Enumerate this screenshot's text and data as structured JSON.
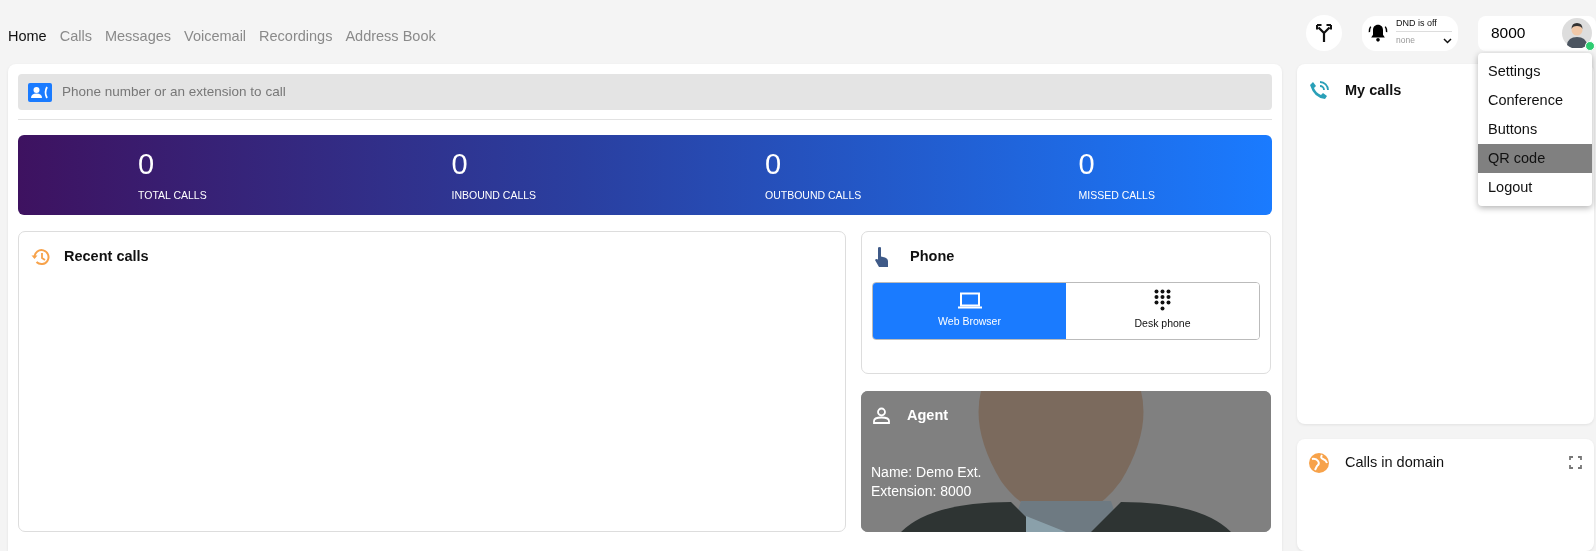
{
  "nav": {
    "tabs": [
      {
        "label": "Home",
        "selected": true
      },
      {
        "label": "Calls",
        "selected": false
      },
      {
        "label": "Messages",
        "selected": false
      },
      {
        "label": "Voicemail",
        "selected": false
      },
      {
        "label": "Recordings",
        "selected": false
      },
      {
        "label": "Address Book",
        "selected": false
      }
    ]
  },
  "header": {
    "dnd": {
      "status": "DND is off",
      "value": "none"
    },
    "user": {
      "extension": "8000",
      "online": true
    },
    "menu": [
      {
        "label": "Settings",
        "selected": false
      },
      {
        "label": "Conference",
        "selected": false
      },
      {
        "label": "Buttons",
        "selected": false
      },
      {
        "label": "QR code",
        "selected": true
      },
      {
        "label": "Logout",
        "selected": false
      }
    ]
  },
  "dialer": {
    "placeholder": "Phone number or an extension to call"
  },
  "stats": [
    {
      "value": "0",
      "label": "TOTAL CALLS"
    },
    {
      "value": "0",
      "label": "INBOUND CALLS"
    },
    {
      "value": "0",
      "label": "OUTBOUND CALLS"
    },
    {
      "value": "0",
      "label": "MISSED CALLS"
    }
  ],
  "recent_calls": {
    "title": "Recent calls"
  },
  "phone": {
    "title": "Phone",
    "options": [
      {
        "label": "Web Browser",
        "selected": true,
        "kind": "laptop"
      },
      {
        "label": "Desk phone",
        "selected": false,
        "kind": "keypad"
      }
    ]
  },
  "agent": {
    "title": "Agent",
    "name": "Name: Demo Ext.",
    "extension": "Extension: 8000"
  },
  "my_calls": {
    "title": "My calls"
  },
  "calls_in_domain": {
    "title": "Calls in domain"
  }
}
